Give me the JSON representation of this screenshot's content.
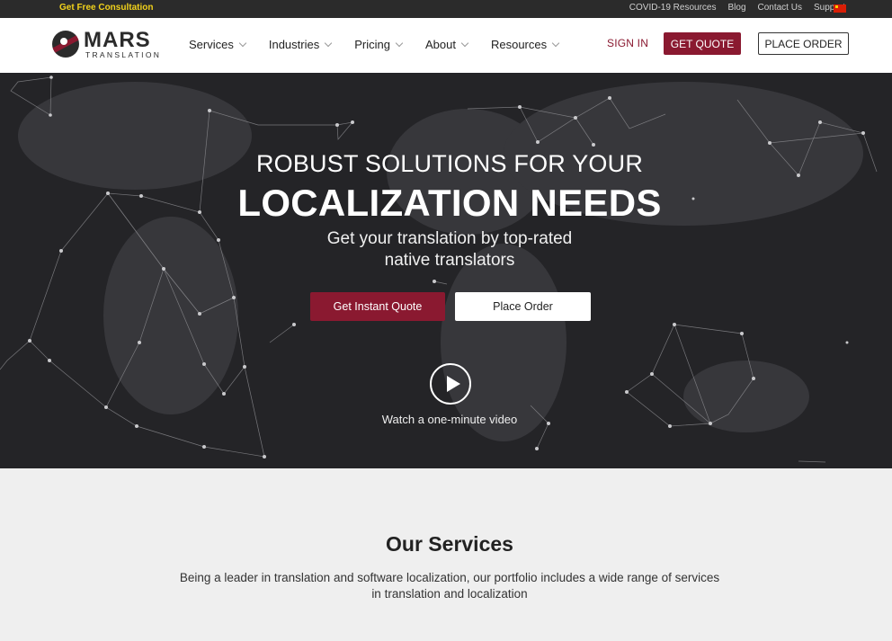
{
  "topbar": {
    "consultation": "Get Free Consultation",
    "links": [
      "COVID-19 Resources",
      "Blog",
      "Contact Us",
      "Support"
    ]
  },
  "header": {
    "logo_word": "MARS",
    "logo_sub": "TRANSLATION",
    "nav": [
      "Services",
      "Industries",
      "Pricing",
      "About",
      "Resources"
    ],
    "sign_in": "SIGN IN",
    "get_quote": "GET QUOTE",
    "place_order": "PLACE ORDER"
  },
  "hero": {
    "line1": "ROBUST SOLUTIONS FOR YOUR",
    "title": "LOCALIZATION NEEDS",
    "desc_line1": "Get your translation by top-rated",
    "desc_line2": "native translators",
    "primary_cta": "Get Instant Quote",
    "secondary_cta": "Place Order",
    "video_label": "Watch a one-minute video"
  },
  "services": {
    "title": "Our Services",
    "desc": "Being a leader in translation and software localization, our portfolio includes a wide range of services in translation and localization"
  },
  "colors": {
    "brand": "#8a1930",
    "topbar_bg": "#2b2b2b",
    "hero_bg": "#242427",
    "consult_text": "#f2d21b"
  }
}
